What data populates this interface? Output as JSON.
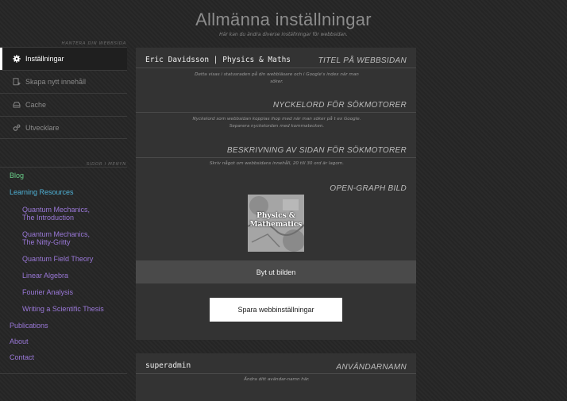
{
  "header": {
    "title": "Allmänna inställningar",
    "subtitle": "Här kan du ändra diverse inställningar för webbsidan."
  },
  "sidebar": {
    "section_manage": "HANTERA DIN WEBBSIDA",
    "items": [
      {
        "label": "Inställningar",
        "icon": "gear-icon",
        "active": true
      },
      {
        "label": "Skapa nytt innehåll",
        "icon": "new-content-icon",
        "active": false
      },
      {
        "label": "Cache",
        "icon": "cache-icon",
        "active": false
      },
      {
        "label": "Utvecklare",
        "icon": "developer-gears-icon",
        "active": false
      }
    ],
    "section_menu": "SIDOR I MENYN",
    "menu": {
      "blog": "Blog",
      "learning": "Learning Resources",
      "sub": [
        [
          "Quantum Mechanics,",
          "The Introduction"
        ],
        [
          "Quantum Mechanics,",
          "The Nitty-Gritty"
        ],
        [
          "Quantum Field Theory"
        ],
        [
          "Linear Algebra"
        ],
        [
          "Fourier Analysis"
        ],
        [
          "Writing a Scientific Thesis"
        ]
      ],
      "publications": "Publications",
      "about": "About",
      "contact": "Contact"
    },
    "colors": {
      "blog": "#6ad08a",
      "learning": "#4fb3d8",
      "links": "#9a78d8"
    }
  },
  "settings": {
    "site_title": {
      "value": "Eric Davidsson | Physics & Maths",
      "label": "TITEL PÅ WEBBSIDAN",
      "help": "Detta visas i statusraden på din webbläsare och i Google's index när man söker."
    },
    "keywords": {
      "label": "NYCKELORD FÖR SÖKMOTORER",
      "help": "Nyckelord som webbsidan kopplas ihop med när man söker på t ex Google. Separera nyckelorden med kommatecken."
    },
    "description": {
      "label": "BESKRIVNING AV SIDAN FÖR SÖKMOTORER",
      "help": "Skriv något om webbsidans innehåll, 20 till 30 ord är lagom."
    },
    "og_image": {
      "label": "OPEN-GRAPH BILD",
      "image_text_1": "Physics &",
      "image_text_2": "Mathematics"
    },
    "replace_image_button": "Byt ut bilden",
    "save_button": "Spara webbinställningar"
  },
  "user": {
    "username": "superadmin",
    "label": "ANVÄNDARNAMN",
    "help": "Ändra ditt avändar-namn här."
  }
}
